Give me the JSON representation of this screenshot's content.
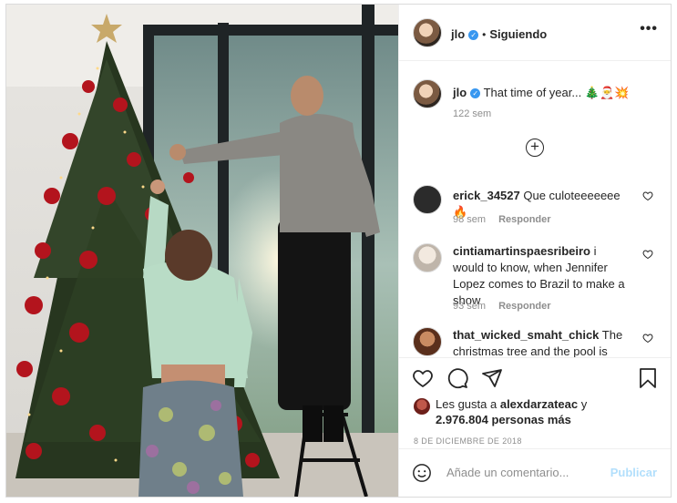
{
  "post": {
    "username": "jlo",
    "separator": "•",
    "follow_status": "Siguiendo",
    "more_icon": "more-horizontal-icon",
    "caption": {
      "username": "jlo",
      "text": "That time of year... 🎄🎅💥",
      "time": "122 sem"
    },
    "load_more_icon": "plus-circle-icon",
    "comments": [
      {
        "username": "erick_34527",
        "text": "Que culoteeeeeee🔥",
        "time": "98 sem",
        "reply": "Responder",
        "avatar_color": "#2b2b2b"
      },
      {
        "username": "cintiamartinspaesribeiro",
        "text": "i would to know, when Jennifer Lopez comes to Brazil to make a show",
        "time": "93 sem",
        "reply": "Responder",
        "avatar_color": "#cfc9c0"
      },
      {
        "username": "that_wicked_smaht_chick",
        "text": "The christmas tree and the pool is",
        "time": "",
        "reply": "",
        "avatar_color": "#7a4c2e"
      }
    ],
    "actions": [
      "heart-icon",
      "comment-icon",
      "share-icon",
      "bookmark-icon"
    ],
    "likes": {
      "prefix": "Les gusta a",
      "user": "alexdarzateac",
      "connector": "y",
      "count": "2.976.804 personas más"
    },
    "date": "8 DE DICIEMBRE DE 2018",
    "add_comment": {
      "placeholder": "Añade un comentario...",
      "publish": "Publicar",
      "emoji_icon": "emoji-smile-icon"
    }
  },
  "colors": {
    "accent_blue": "#3897f0",
    "publish_disabled": "#b2dffc",
    "muted_text": "#8e8e8e",
    "border": "#dbdbdb"
  }
}
